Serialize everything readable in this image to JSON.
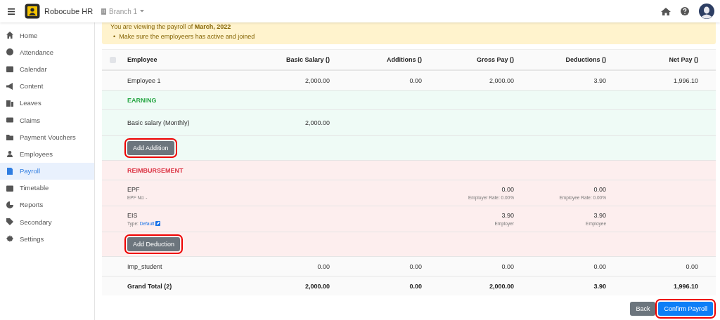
{
  "header": {
    "app_name": "Robocube HR",
    "branch": "Branch 1"
  },
  "sidebar": {
    "items": [
      {
        "label": "Home",
        "selected": false
      },
      {
        "label": "Attendance",
        "selected": false
      },
      {
        "label": "Calendar",
        "selected": false
      },
      {
        "label": "Content",
        "selected": false
      },
      {
        "label": "Leaves",
        "selected": false
      },
      {
        "label": "Claims",
        "selected": false
      },
      {
        "label": "Payment Vouchers",
        "selected": false
      },
      {
        "label": "Employees",
        "selected": false
      },
      {
        "label": "Payroll",
        "selected": true
      },
      {
        "label": "Timetable",
        "selected": false
      },
      {
        "label": "Reports",
        "selected": false
      },
      {
        "label": "Secondary",
        "selected": false
      },
      {
        "label": "Settings",
        "selected": false
      }
    ]
  },
  "alert": {
    "text": "You are viewing the payroll of **March, 2022**",
    "bullets": [
      {
        "marker": "•",
        "text": "Make sure the employeers has active and joined"
      }
    ]
  },
  "table": {
    "select_all_checked": false,
    "columns": [
      "Employee",
      "Basic Salary ()",
      "Additions ()",
      "Gross Pay ()",
      "Deductions ()",
      "Net Pay ()"
    ],
    "rows": [
      {
        "kind": "employee",
        "label": "Employee 1",
        "basic_salary": {
          "value": "2,000.00"
        },
        "additions": {
          "value": "0.00"
        },
        "gross_pay": {
          "value": "2,000.00"
        },
        "deductions": {
          "value": "3.90"
        },
        "net_pay": {
          "value": "1,996.10"
        }
      },
      {
        "kind": "earning",
        "label": "EARNING",
        "rows": [
          {
            "kind": "item",
            "label": "Basic salary (Monthly)",
            "basic_salary": {
              "value": "2,000.00"
            }
          },
          {
            "kind": "action",
            "label": "Add Addition",
            "highlighted": true
          }
        ]
      },
      {
        "kind": "deduction",
        "label": "REIMBURSEMENT",
        "rows": [
          {
            "kind": "item",
            "label": "EPF",
            "note": "EPF No: -",
            "gross_pay": {
              "value": "0.00",
              "note": "Employer Rate: 0.00%"
            },
            "deductions": {
              "value": "0.00",
              "note": "Employee Rate: 0.00%"
            }
          },
          {
            "kind": "item",
            "label": "EIS",
            "note": "Type:",
            "note_link": "Default",
            "gross_pay": {
              "value": "3.90",
              "note": "Employer"
            },
            "deductions": {
              "value": "3.90",
              "note": "Employee"
            }
          },
          {
            "kind": "action",
            "label": "Add Deduction",
            "highlighted": true
          }
        ]
      },
      {
        "kind": "employee",
        "label": "Imp_student",
        "basic_salary": {
          "value": "0.00"
        },
        "additions": {
          "value": "0.00"
        },
        "gross_pay": {
          "value": "0.00"
        },
        "deductions": {
          "value": "0.00"
        },
        "net_pay": {
          "value": "0.00"
        }
      },
      {
        "kind": "total",
        "label": "Grand Total (2)",
        "basic_salary": {
          "value": "2,000.00"
        },
        "additions": {
          "value": "0.00"
        },
        "gross_pay": {
          "value": "2,000.00"
        },
        "deductions": {
          "value": "3.90"
        },
        "net_pay": {
          "value": "1,996.10"
        }
      }
    ]
  },
  "buttons": [
    {
      "label": "Back",
      "kind": "secondary",
      "highlighted": false
    },
    {
      "label": "Confirm Payroll",
      "kind": "primary",
      "highlighted": true
    }
  ]
}
